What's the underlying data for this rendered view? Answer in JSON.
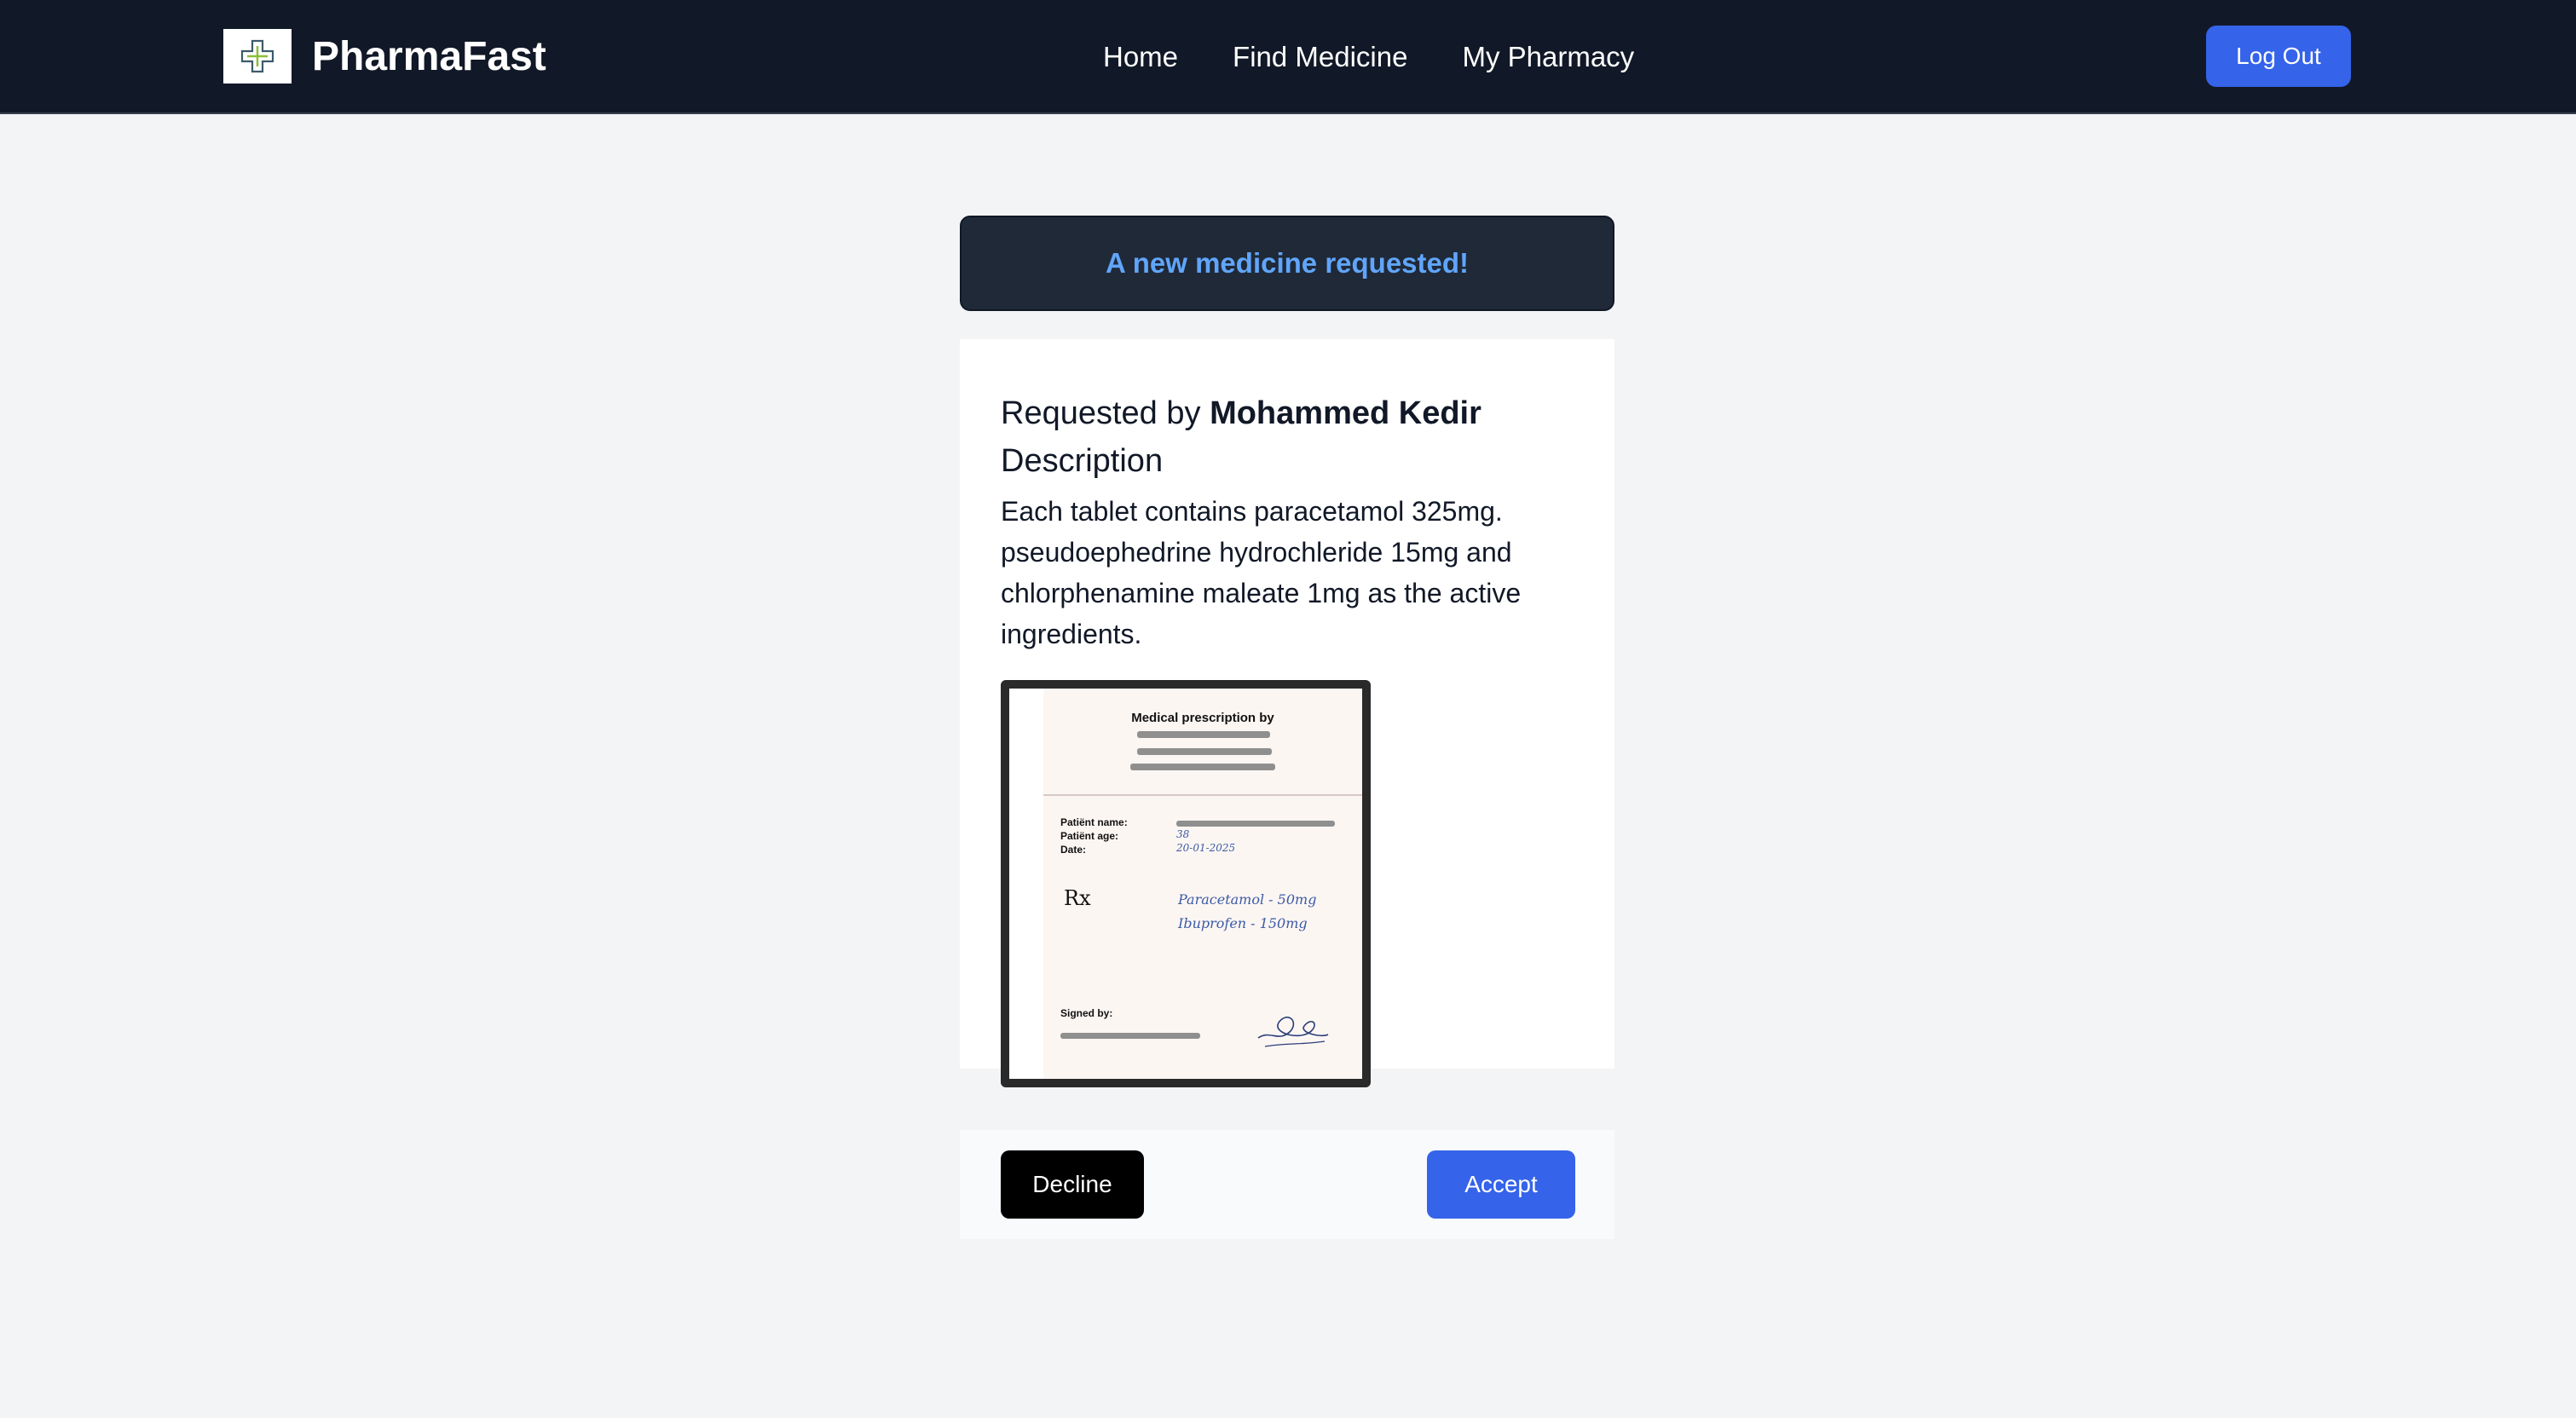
{
  "header": {
    "brand": "PharmaFast",
    "logo_icon": "medical-cross-icon",
    "nav": [
      "Home",
      "Find Medicine",
      "My Pharmacy"
    ],
    "logout_label": "Log Out"
  },
  "banner": {
    "text": "A new medicine requested!"
  },
  "request": {
    "requested_prefix": "Requested by",
    "requester_name": "Mohammed Kedir",
    "description_title": "Description",
    "description_text": "Each tablet contains paracetamol 325mg. pseudoephedrine hydrochleride 15mg and chlorphenamine maleate 1mg as the active ingredients."
  },
  "prescription_image": {
    "title": "Medical prescription by",
    "patient_name_label": "Patiënt name:",
    "patient_age_label": "Patiënt age:",
    "date_label": "Date:",
    "patient_age": "38",
    "date": "20-01-2025",
    "rx_symbol": "Rx",
    "lines": [
      "Paracetamol - 50mg",
      "Ibuprofen - 150mg"
    ],
    "signed_label": "Signed by:"
  },
  "actions": {
    "decline_label": "Decline",
    "accept_label": "Accept"
  },
  "colors": {
    "navbar": "#111827",
    "primary": "#3563e9",
    "banner_text": "#60a5fa"
  }
}
